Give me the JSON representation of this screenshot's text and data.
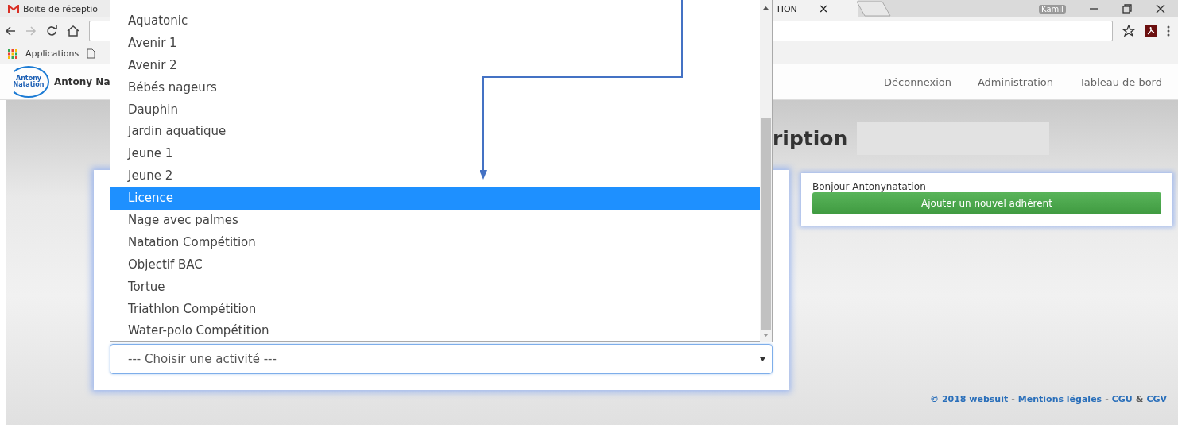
{
  "browser": {
    "tabs": [
      {
        "title": "Boite de réceptio",
        "selected": false
      },
      {
        "title": "TION",
        "selected": true
      }
    ],
    "tab_close": "×",
    "user": "Kamil",
    "bookmarks": [
      "Applications"
    ]
  },
  "site": {
    "logo_text": "Antony Natation",
    "brand": "Antony Na",
    "nav": [
      "Déconnexion",
      "Administration",
      "Tableau de bord"
    ]
  },
  "heading": "ription",
  "activity_select": {
    "value": "--- Choisir une activité ---",
    "expanded": true,
    "options": [
      {
        "label": "Aquatonic",
        "selected": false
      },
      {
        "label": "Avenir 1",
        "selected": false
      },
      {
        "label": "Avenir 2",
        "selected": false
      },
      {
        "label": "Bébés nageurs",
        "selected": false
      },
      {
        "label": "Dauphin",
        "selected": false
      },
      {
        "label": "Jardin aquatique",
        "selected": false
      },
      {
        "label": "Jeune 1",
        "selected": false
      },
      {
        "label": "Jeune 2",
        "selected": false
      },
      {
        "label": "Licence",
        "selected": true
      },
      {
        "label": "Nage avec palmes",
        "selected": false
      },
      {
        "label": "Natation Compétition",
        "selected": false
      },
      {
        "label": "Objectif BAC",
        "selected": false
      },
      {
        "label": "Tortue",
        "selected": false
      },
      {
        "label": "Triathlon Compétition",
        "selected": false
      },
      {
        "label": "Water-polo Compétition",
        "selected": false
      }
    ]
  },
  "welcome": "Bonjour Antonynatation",
  "add_button": "Ajouter un nouvel adhérent",
  "footer": [
    {
      "text": "© 2018 websuit",
      "kind": "link"
    },
    {
      "text": "-",
      "kind": "sep"
    },
    {
      "text": "Mentions légales",
      "kind": "link"
    },
    {
      "text": "-",
      "kind": "sep"
    },
    {
      "text": "CGU",
      "kind": "link"
    },
    {
      "text": "&",
      "kind": "sep"
    },
    {
      "text": "CGV",
      "kind": "link"
    }
  ]
}
